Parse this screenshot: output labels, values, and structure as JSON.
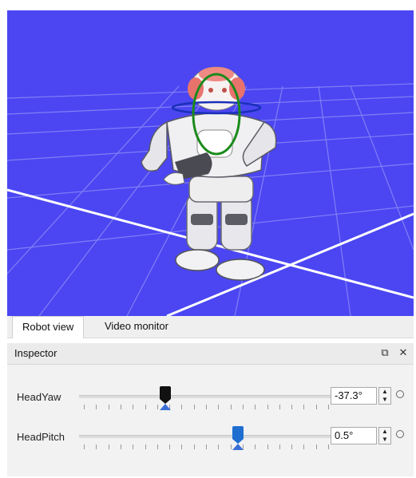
{
  "tabs": [
    {
      "label": "Robot view",
      "active": true
    },
    {
      "label": "Video monitor",
      "active": false
    }
  ],
  "inspector": {
    "title": "Inspector",
    "float_icon": "float-window-icon",
    "close_icon": "close-icon"
  },
  "joints": [
    {
      "label": "HeadYaw",
      "value": "-37.3°",
      "position": 0.34,
      "thumb_color": "#111111"
    },
    {
      "label": "HeadPitch",
      "value": "0.5°",
      "position": 0.625,
      "thumb_color": "#1f6fd1"
    }
  ],
  "colors": {
    "viewport_bg": "#4b46f2",
    "grid": "#8f8cf7",
    "floor_line": "#ffffff",
    "ring": "#1b8a1b"
  }
}
